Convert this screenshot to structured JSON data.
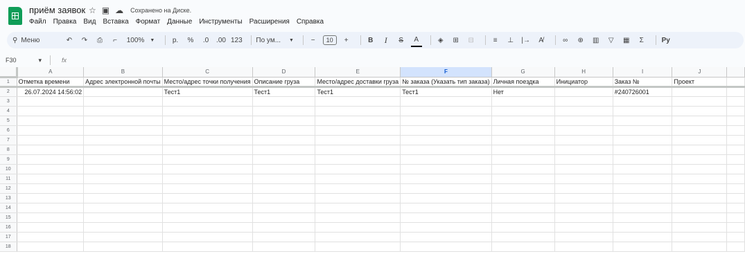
{
  "doc": {
    "title": "приём заявок",
    "saved_status": "Сохранено на Диске."
  },
  "menu": [
    "Файл",
    "Правка",
    "Вид",
    "Вставка",
    "Формат",
    "Данные",
    "Инструменты",
    "Расширения",
    "Справка"
  ],
  "toolbar": {
    "search_label": "Меню",
    "zoom": "100%",
    "currency": "р.",
    "percent": "%",
    "decrease_decimals": ".0",
    "increase_decimals": ".00",
    "number_format": "123",
    "font": "По ум...",
    "font_size": "10",
    "minus": "−",
    "plus": "+",
    "bold": "B",
    "italic": "I",
    "strike": "S",
    "text_color": "A",
    "sum": "Σ"
  },
  "formula_bar": {
    "cell_ref": "F30",
    "fx": "fx"
  },
  "columns": [
    "A",
    "B",
    "C",
    "D",
    "E",
    "F",
    "G",
    "H",
    "I",
    "J"
  ],
  "selected_column": "F",
  "rows": [
    [
      "Отметка времени",
      "Адрес электронной почты",
      "Место/адрес точки получения",
      "Описание груза",
      "Место/адрес доставки груза",
      "№ заказа (Указать тип заказа)",
      "Личная поездка",
      "Инициатор",
      "Заказ №",
      "Проект"
    ],
    [
      "26.07.2024 14:56:02",
      "",
      "Тест1",
      "Тест1",
      "Тест1",
      "Тест1",
      "Нет",
      "",
      "#240726001",
      ""
    ],
    [
      "",
      "",
      "",
      "",
      "",
      "",
      "",
      "",
      "",
      ""
    ],
    [
      "",
      "",
      "",
      "",
      "",
      "",
      "",
      "",
      "",
      ""
    ],
    [
      "",
      "",
      "",
      "",
      "",
      "",
      "",
      "",
      "",
      ""
    ],
    [
      "",
      "",
      "",
      "",
      "",
      "",
      "",
      "",
      "",
      ""
    ],
    [
      "",
      "",
      "",
      "",
      "",
      "",
      "",
      "",
      "",
      ""
    ],
    [
      "",
      "",
      "",
      "",
      "",
      "",
      "",
      "",
      "",
      ""
    ],
    [
      "",
      "",
      "",
      "",
      "",
      "",
      "",
      "",
      "",
      ""
    ],
    [
      "",
      "",
      "",
      "",
      "",
      "",
      "",
      "",
      "",
      ""
    ],
    [
      "",
      "",
      "",
      "",
      "",
      "",
      "",
      "",
      "",
      ""
    ],
    [
      "",
      "",
      "",
      "",
      "",
      "",
      "",
      "",
      "",
      ""
    ],
    [
      "",
      "",
      "",
      "",
      "",
      "",
      "",
      "",
      "",
      ""
    ],
    [
      "",
      "",
      "",
      "",
      "",
      "",
      "",
      "",
      "",
      ""
    ],
    [
      "",
      "",
      "",
      "",
      "",
      "",
      "",
      "",
      "",
      ""
    ],
    [
      "",
      "",
      "",
      "",
      "",
      "",
      "",
      "",
      "",
      ""
    ],
    [
      "",
      "",
      "",
      "",
      "",
      "",
      "",
      "",
      "",
      ""
    ],
    [
      "",
      "",
      "",
      "",
      "",
      "",
      "",
      "",
      "",
      ""
    ]
  ],
  "row_numbers": [
    "1",
    "2",
    "3",
    "4",
    "5",
    "6",
    "7",
    "8",
    "9",
    "10",
    "11",
    "12",
    "13",
    "14",
    "15",
    "16",
    "17",
    "18"
  ],
  "icons": {
    "star": "star-icon",
    "folder": "move-folder-icon",
    "cloud": "cloud-saved-icon"
  },
  "colors": {
    "brand": "#0f9d58",
    "toolbar_bg": "#edf2fa",
    "selected_header": "#d3e3fd"
  }
}
